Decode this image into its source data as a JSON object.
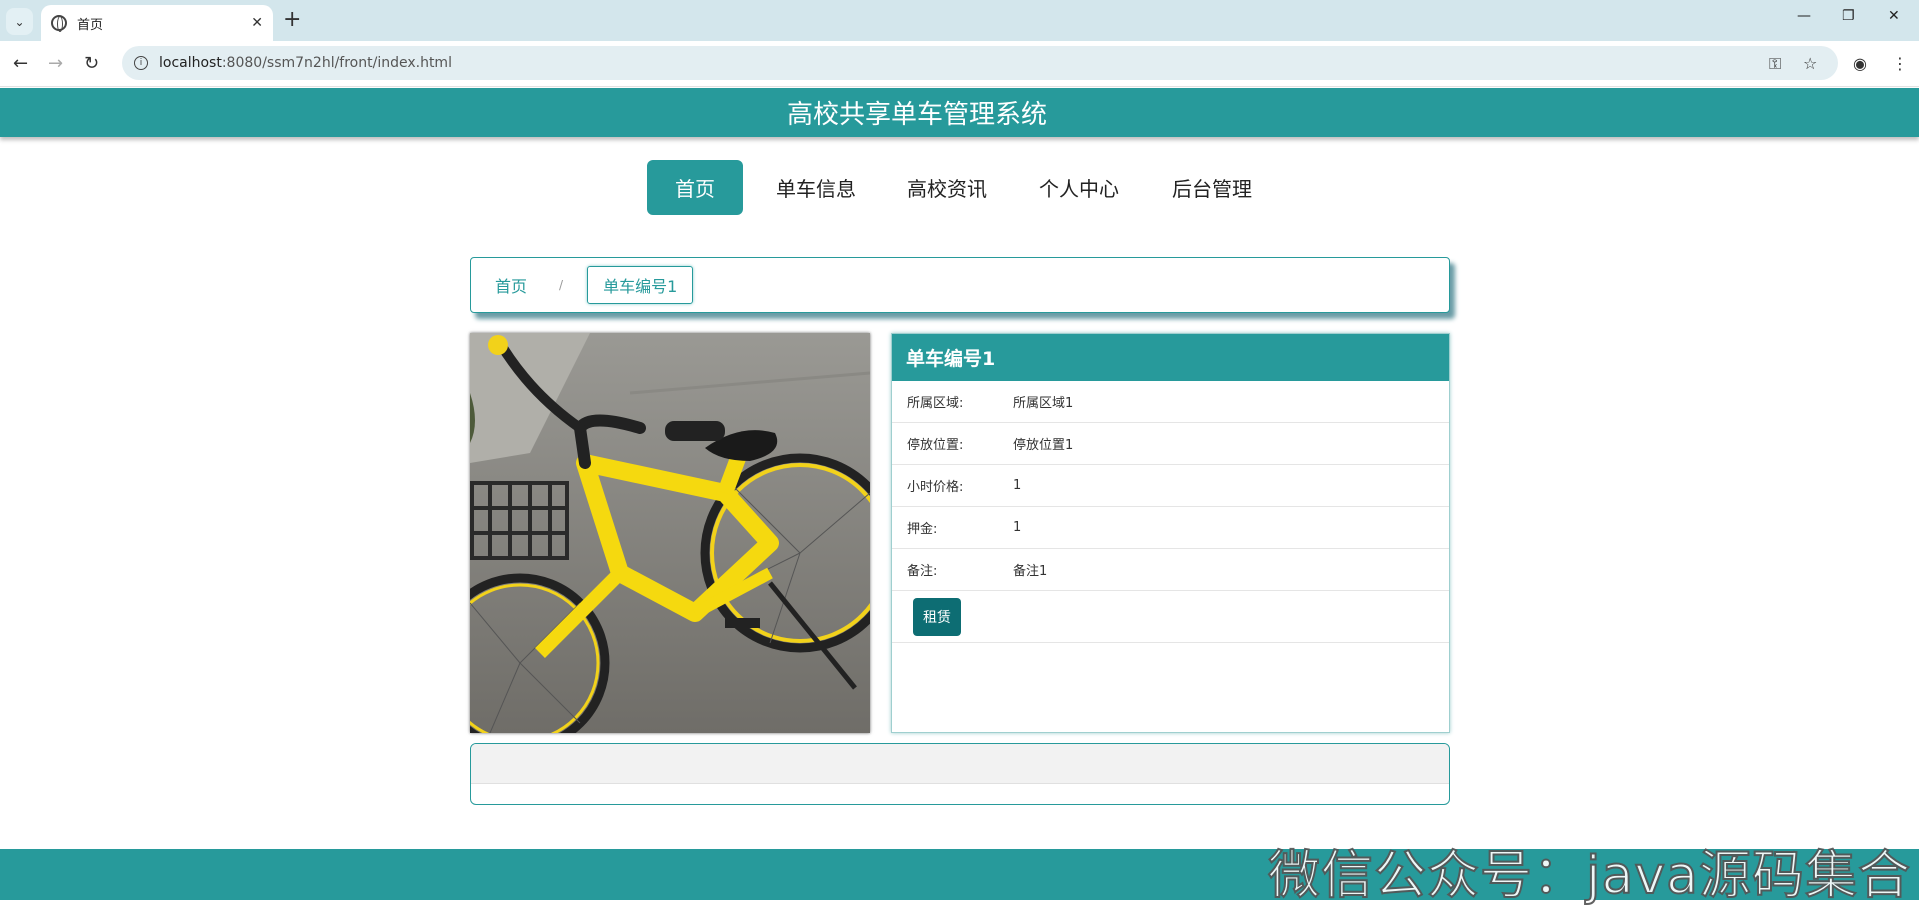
{
  "browser": {
    "tab_title": "首页",
    "url_host": "localhost",
    "url_rest": ":8080/ssm7n2hl/front/index.html"
  },
  "header": {
    "title": "高校共享单车管理系统"
  },
  "nav": [
    {
      "label": "首页",
      "active": true
    },
    {
      "label": "单车信息",
      "active": false
    },
    {
      "label": "高校资讯",
      "active": false
    },
    {
      "label": "个人中心",
      "active": false
    },
    {
      "label": "后台管理",
      "active": false
    }
  ],
  "breadcrumb": {
    "home": "首页",
    "separator": "/",
    "current": "单车编号1"
  },
  "detail": {
    "title": "单车编号1",
    "fields": [
      {
        "label": "所属区域:",
        "value": "所属区域1"
      },
      {
        "label": "停放位置:",
        "value": "停放位置1"
      },
      {
        "label": "小时价格:",
        "value": "1"
      },
      {
        "label": "押金:",
        "value": "1"
      },
      {
        "label": "备注:",
        "value": "备注1"
      }
    ],
    "rent_label": "租赁"
  },
  "watermark": "微信公众号：java源码集合",
  "colors": {
    "primary": "#279a9b",
    "button_dark": "#0d6d73",
    "chrome": "#d3e6ec"
  }
}
